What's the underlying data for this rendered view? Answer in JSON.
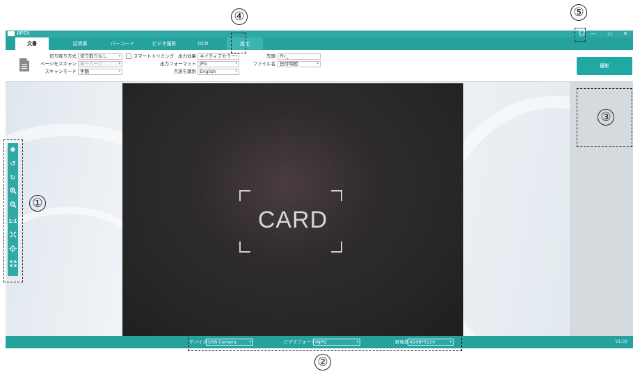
{
  "window": {
    "title": "APEX",
    "minimize": "—",
    "restore": "▭",
    "close": "✕",
    "skin": "👕"
  },
  "tabs": [
    {
      "label": "文書"
    },
    {
      "label": "証明書"
    },
    {
      "label": "バーコード"
    },
    {
      "label": "ビデオ撮影"
    },
    {
      "label": "OCR"
    },
    {
      "label": "設定"
    }
  ],
  "toolbar": {
    "crop_mode_label": "切り取り方式",
    "crop_mode_value": "切り取りなし",
    "page_scan_label": "ページをスキャン",
    "page_scan_value": "単一ページ",
    "scan_mode_label": "スキャンモード",
    "scan_mode_value": "手動",
    "smart_trim_label": "スマートトリミング",
    "output_effect_label": "出力効果",
    "output_effect_value": "ネイティブカラー",
    "output_format_label": "出力フォーマット",
    "output_format_value": "JPG",
    "language_label": "言語を識別",
    "language_value": "English",
    "prefix_label": "先頭",
    "prefix_value": "Pic_",
    "filename_label": "ファイル名",
    "filename_value": "日付時間",
    "capture_label": "撮影"
  },
  "preview": {
    "card_text": "CARD"
  },
  "left_tools": [
    "settings-icon",
    "rotate-left-icon",
    "rotate-right-icon",
    "zoom-in-icon",
    "zoom-out-icon",
    "actual-size-icon",
    "fit-screen-icon",
    "focus-icon",
    "fullscreen-icon"
  ],
  "status": {
    "device_label": "デバイス",
    "device_value": "USB Camera",
    "video_format_label": "ビデオフォーマット",
    "video_format_value": "MJPG",
    "resolution_label": "解像度",
    "resolution_value": "4208*3120",
    "version": "V1.03"
  },
  "callouts": {
    "c1": "①",
    "c2": "②",
    "c3": "③",
    "c4": "④",
    "c5": "⑤"
  },
  "colors": {
    "accent": "#25a19e",
    "button": "#1fa8a4"
  }
}
